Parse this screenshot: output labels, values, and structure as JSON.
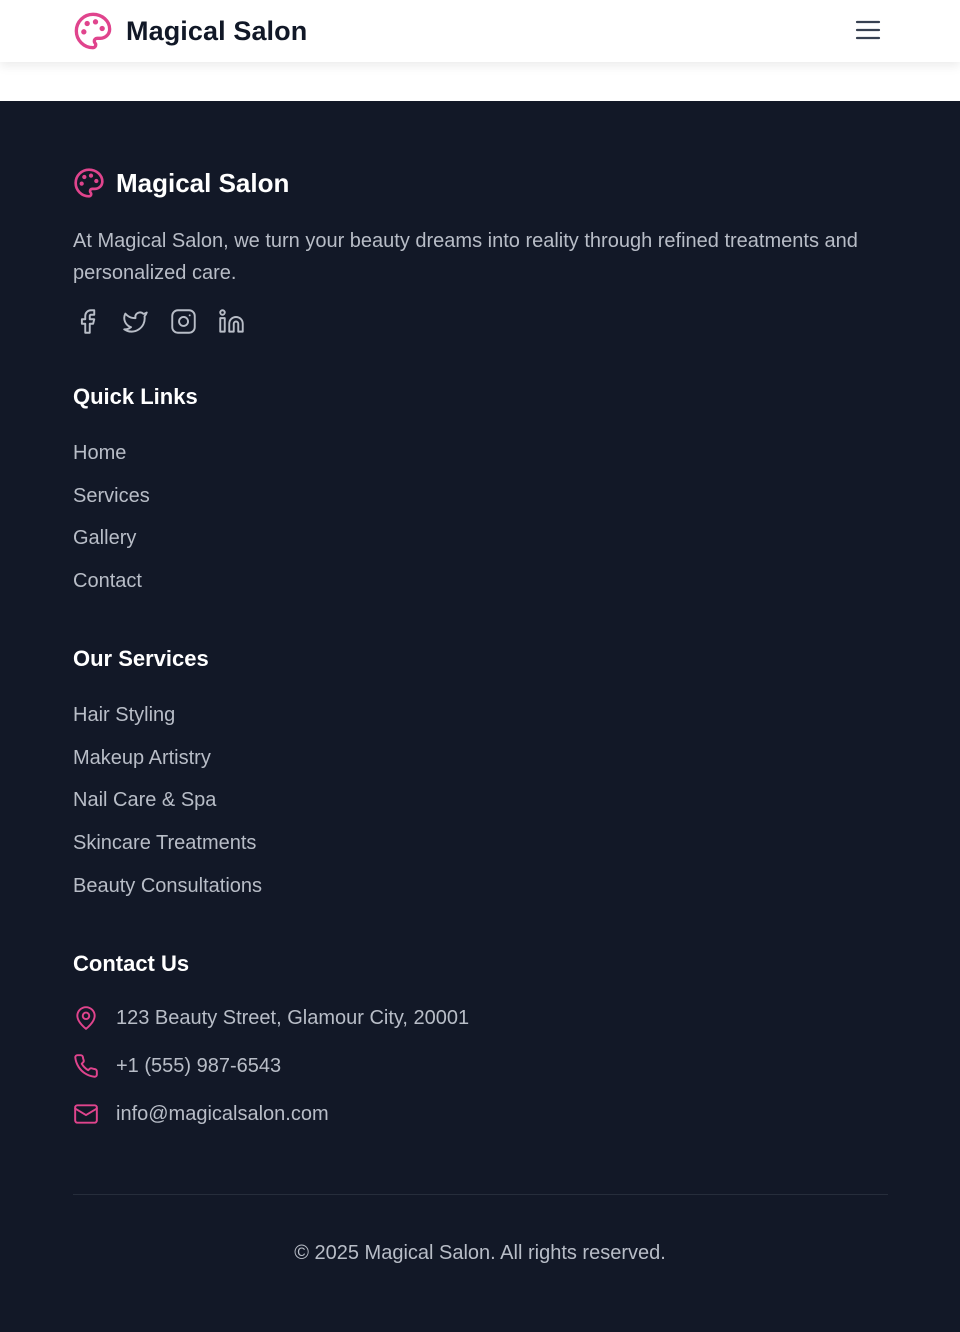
{
  "header": {
    "brand_name": "Magical Salon",
    "logo_icon": "palette-icon",
    "menu_icon": "hamburger-menu-icon"
  },
  "footer": {
    "brand_name": "Magical Salon",
    "about": "At Magical Salon, we turn your beauty dreams into reality through refined treatments and personalized care.",
    "socials": [
      {
        "icon": "facebook-icon"
      },
      {
        "icon": "twitter-icon"
      },
      {
        "icon": "instagram-icon"
      },
      {
        "icon": "linkedin-icon"
      }
    ],
    "quick_links": {
      "title": "Quick Links",
      "items": [
        "Home",
        "Services",
        "Gallery",
        "Contact"
      ]
    },
    "services": {
      "title": "Our Services",
      "items": [
        "Hair Styling",
        "Makeup Artistry",
        "Nail Care & Spa",
        "Skincare Treatments",
        "Beauty Consultations"
      ]
    },
    "contact": {
      "title": "Contact Us",
      "items": [
        {
          "icon": "map-pin-icon",
          "text": "123 Beauty Street, Glamour City, 20001"
        },
        {
          "icon": "phone-icon",
          "text": "+1 (555) 987-6543"
        },
        {
          "icon": "mail-icon",
          "text": "info@magicalsalon.com"
        }
      ]
    },
    "copyright": "© 2025 Magical Salon. All rights reserved."
  },
  "colors": {
    "accent": "#e0448d",
    "footer_bg": "#121827",
    "heading": "#ffffff",
    "text_muted": "#b8bdc7",
    "header_text": "#111827"
  }
}
